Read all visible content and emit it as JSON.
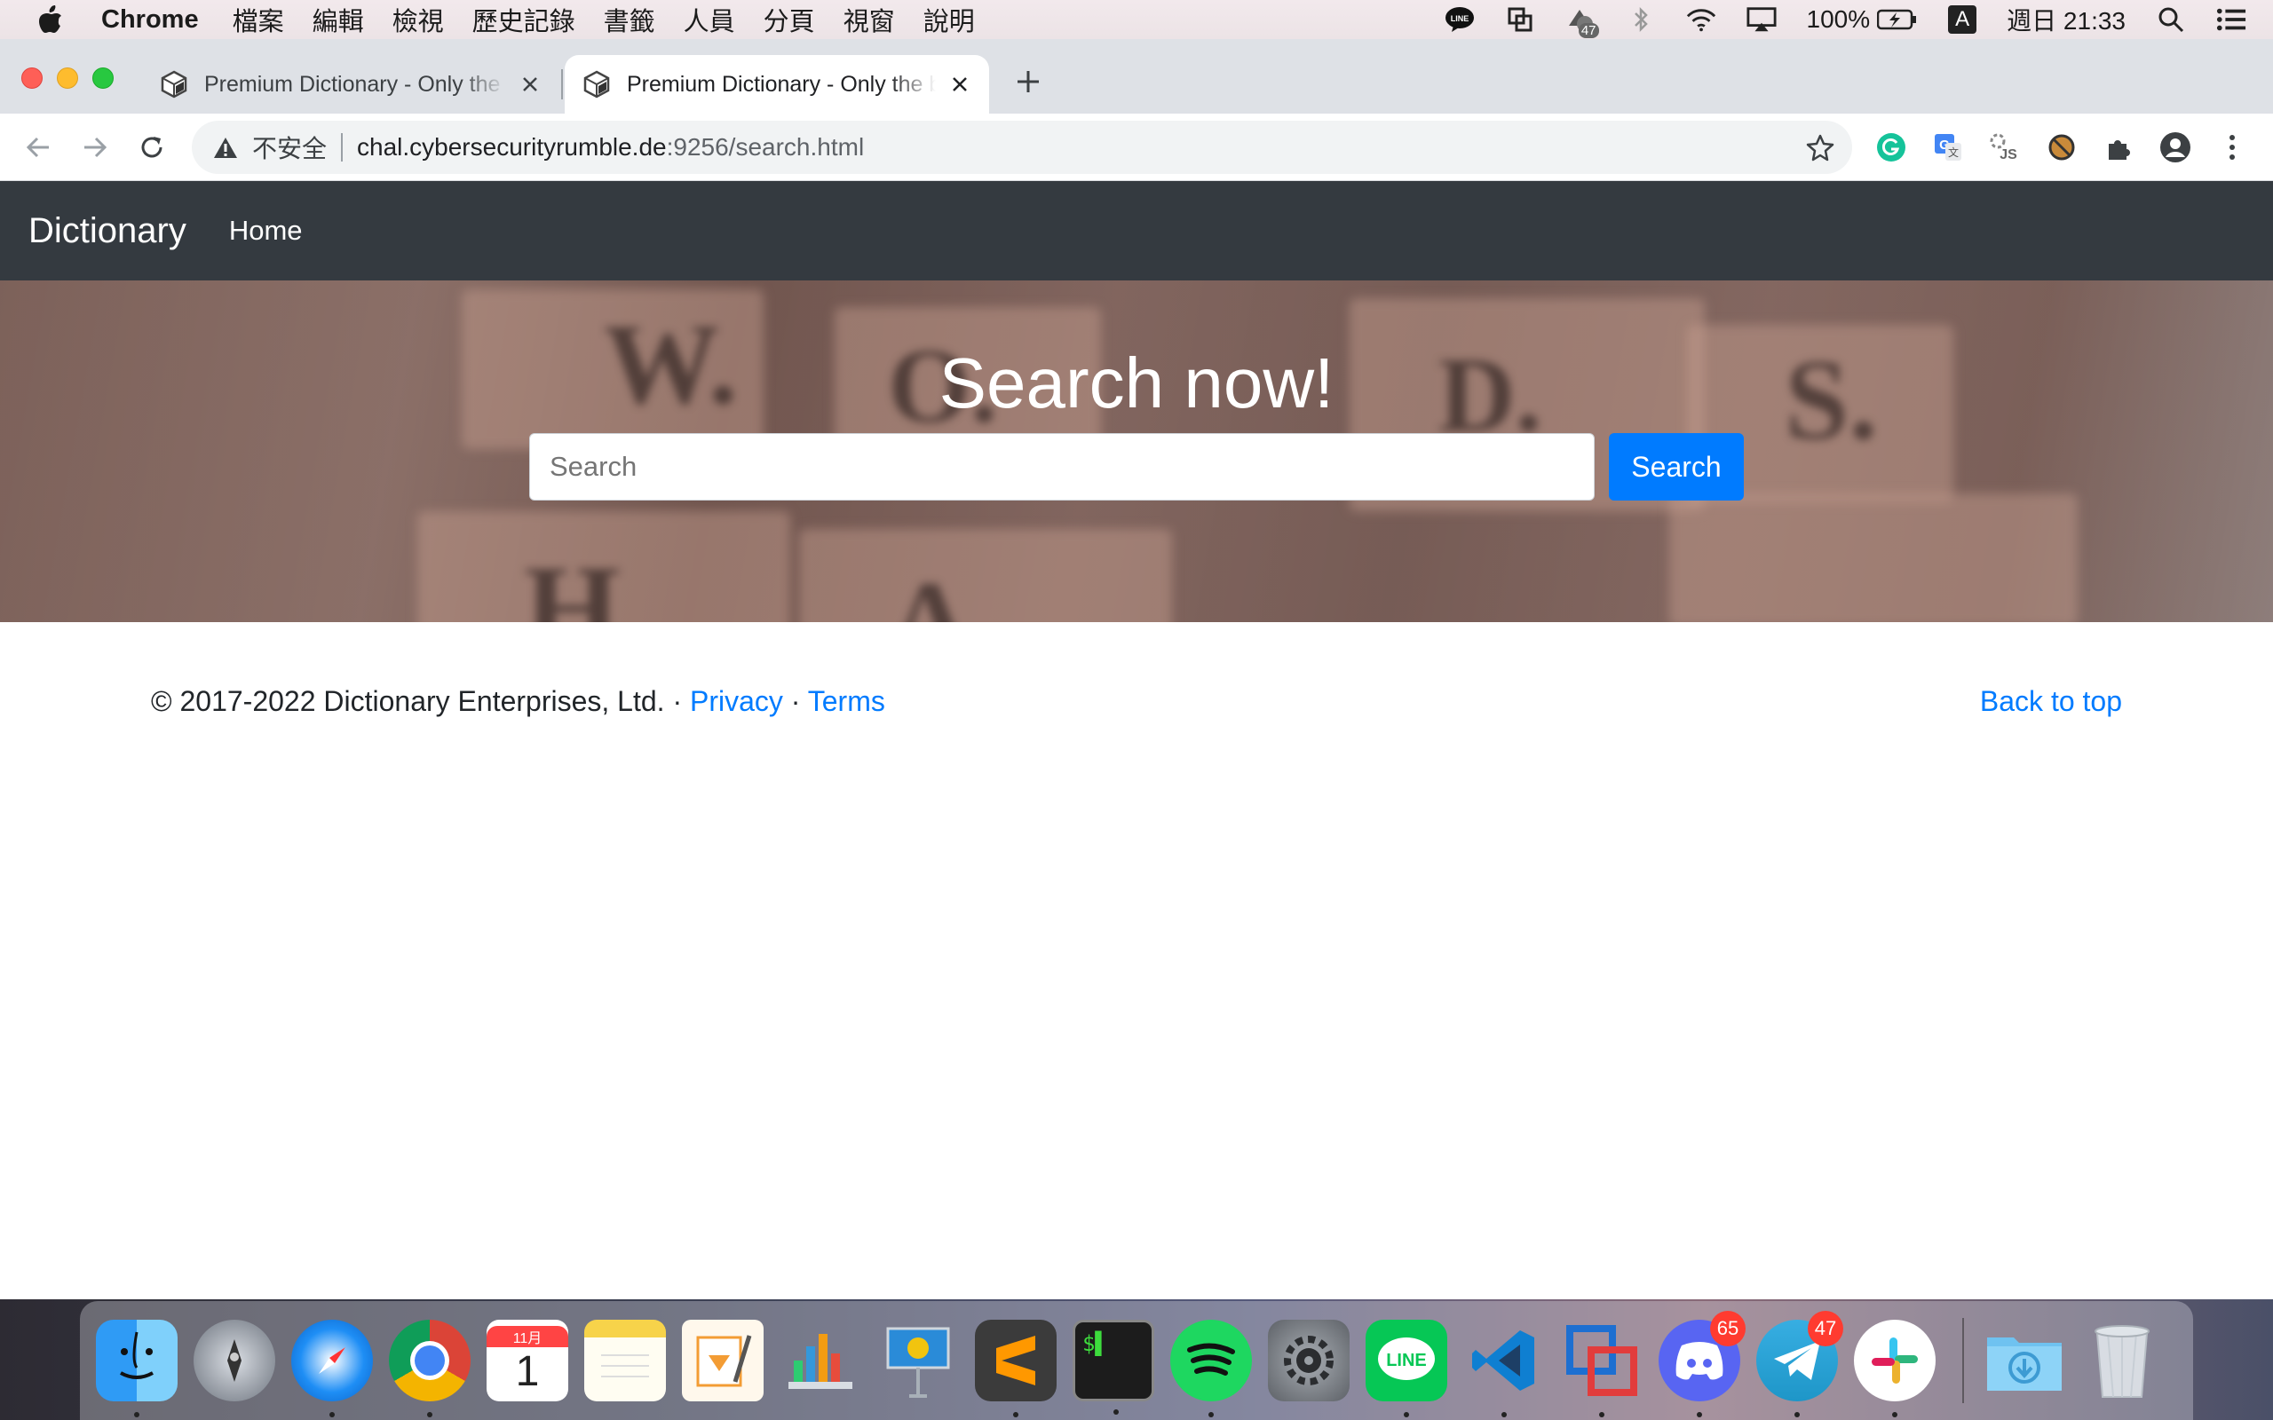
{
  "menubar": {
    "app_name": "Chrome",
    "menus": [
      "檔案",
      "編輯",
      "檢視",
      "歷史記錄",
      "書籤",
      "人員",
      "分頁",
      "視窗",
      "說明"
    ],
    "status_badge_count": "47",
    "battery": "100%",
    "input_method": "A",
    "clock": "週日 21:33"
  },
  "browser": {
    "tabs": [
      {
        "title": "Premium Dictionary - Only the best words",
        "active": false
      },
      {
        "title": "Premium Dictionary - Only the best words",
        "active": true
      }
    ],
    "security_label": "不安全",
    "url_host": "chal.cybersecurityrumble.de",
    "url_path": ":9256/search.html"
  },
  "page": {
    "brand": "Dictionary",
    "nav_home": "Home",
    "hero_title": "Search now!",
    "search_placeholder": "Search",
    "search_button": "Search",
    "footer_copyright": "© 2017-2022 Dictionary Enterprises, Ltd. · ",
    "footer_privacy": "Privacy",
    "footer_dot": " · ",
    "footer_terms": "Terms",
    "footer_back_to_top": "Back to top"
  },
  "dock": {
    "apps": [
      {
        "name": "Finder",
        "icon": "finder-icon",
        "running": true
      },
      {
        "name": "Launchpad",
        "icon": "launchpad-icon",
        "running": false
      },
      {
        "name": "Safari",
        "icon": "safari-icon",
        "running": true
      },
      {
        "name": "Chrome",
        "icon": "chrome-icon",
        "running": true
      },
      {
        "name": "Calendar",
        "icon": "calendar-icon",
        "running": false,
        "label_month": "11月",
        "label_day": "1"
      },
      {
        "name": "Notes",
        "icon": "notes-icon",
        "running": false
      },
      {
        "name": "Pages",
        "icon": "pages-icon",
        "running": false
      },
      {
        "name": "Numbers",
        "icon": "numbers-icon",
        "running": false
      },
      {
        "name": "Keynote",
        "icon": "keynote-icon",
        "running": false
      },
      {
        "name": "Sublime Text",
        "icon": "sublime-icon",
        "running": true
      },
      {
        "name": "Terminal",
        "icon": "terminal-icon",
        "running": true
      },
      {
        "name": "Spotify",
        "icon": "spotify-icon",
        "running": true
      },
      {
        "name": "System Preferences",
        "icon": "gear-icon",
        "running": false
      },
      {
        "name": "LINE",
        "icon": "line-icon",
        "running": true
      },
      {
        "name": "VS Code",
        "icon": "vscode-icon",
        "running": true
      },
      {
        "name": "VMware",
        "icon": "vmware-icon",
        "running": true
      },
      {
        "name": "Discord",
        "icon": "discord-icon",
        "running": true,
        "badge": "65"
      },
      {
        "name": "Telegram",
        "icon": "telegram-icon",
        "running": true,
        "badge": "47"
      },
      {
        "name": "Slack",
        "icon": "slack-icon",
        "running": true
      }
    ]
  }
}
